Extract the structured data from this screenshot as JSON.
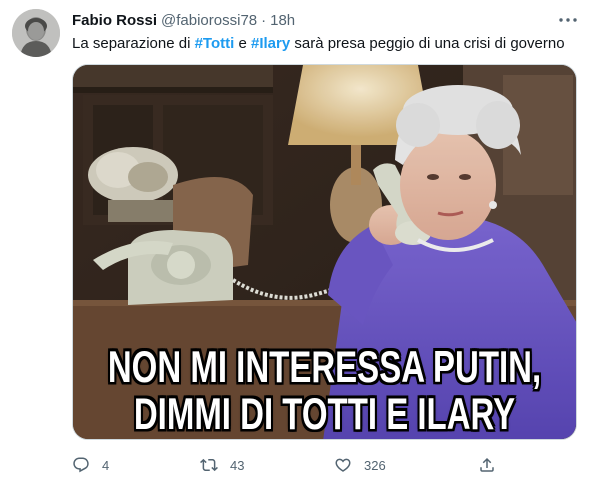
{
  "tweet": {
    "author_name": "Fabio Rossi",
    "author_handle": "@fabiorossi78",
    "separator": "·",
    "time": "18h",
    "text_before": "La separazione di ",
    "hashtag1": "#Totti",
    "text_middle": " e ",
    "hashtag2": "#Ilary",
    "text_after": " sarà presa peggio di una crisi di governo",
    "image": {
      "caption_line1": "NON MI INTERESSA PUTIN,",
      "caption_line2": "DIMMI DI TOTTI E ILARY"
    }
  },
  "actions": {
    "reply_count": "4",
    "retweet_count": "43",
    "like_count": "326",
    "reply_icon": "reply-icon",
    "retweet_icon": "retweet-icon",
    "like_icon": "heart-icon",
    "share_icon": "share-icon"
  },
  "colors": {
    "hashtag": "#1d9bf0",
    "secondary_text": "#536471",
    "primary_text": "#0f1419"
  }
}
